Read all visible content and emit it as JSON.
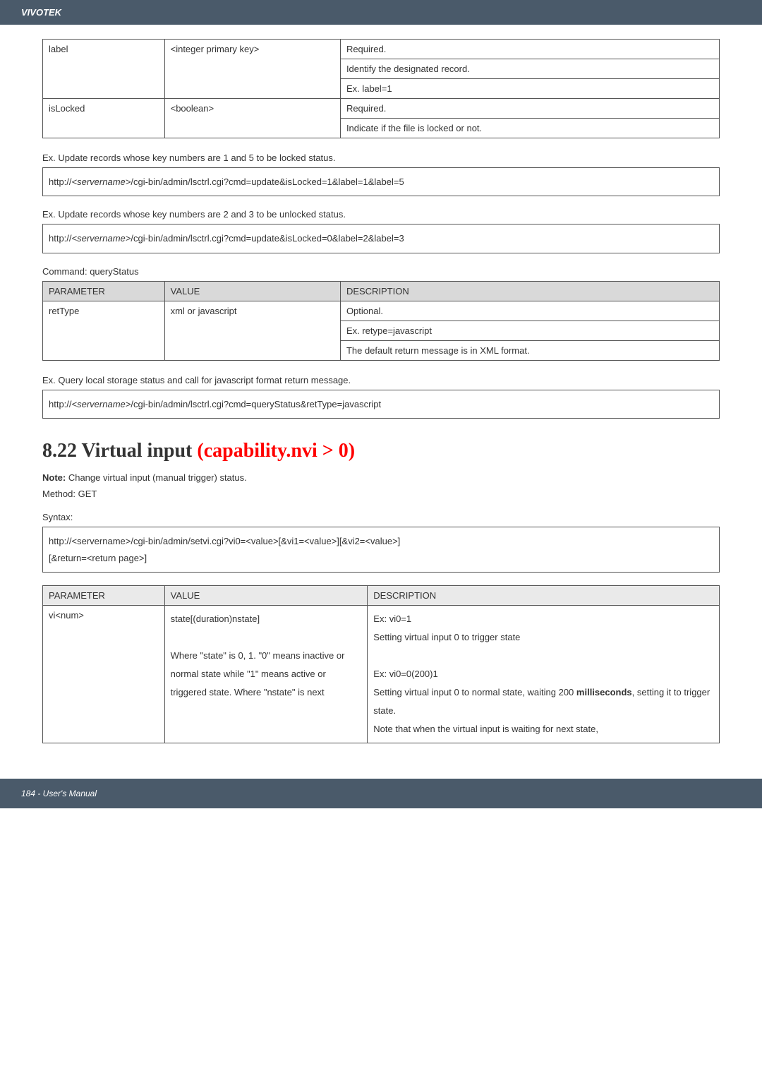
{
  "header": {
    "brand": "VIVOTEK"
  },
  "table1": {
    "rows": [
      {
        "param": "label",
        "value": "<integer primary key>",
        "desc_lines": [
          "Required.",
          "Identify the designated record.",
          "Ex. label=1"
        ]
      },
      {
        "param": "isLocked",
        "value": "<boolean>",
        "desc_lines": [
          "Required.",
          "Indicate if the file is locked or not."
        ]
      }
    ]
  },
  "ex1": {
    "caption": "Ex. Update records whose key numbers are 1 and 5 to be locked status.",
    "url_prefix": "http://",
    "url_server": "<servername>",
    "url_suffix": "/cgi-bin/admin/lsctrl.cgi?cmd=update&isLocked=1&label=1&label=5"
  },
  "ex2": {
    "caption": "Ex. Update records whose key numbers are 2 and 3 to be unlocked status.",
    "url_prefix": "http://",
    "url_server": "<servername>",
    "url_suffix": "/cgi-bin/admin/lsctrl.cgi?cmd=update&isLocked=0&label=2&label=3"
  },
  "command_label": "Command: queryStatus",
  "table2": {
    "headers": {
      "param": "PARAMETER",
      "value": "VALUE",
      "desc": "DESCRIPTION"
    },
    "rows": [
      {
        "param": "retType",
        "value": "xml or javascript",
        "desc_lines": [
          "Optional.",
          "Ex. retype=javascript",
          "The default return message is in XML format."
        ]
      }
    ]
  },
  "ex3": {
    "caption": "Ex. Query local storage status and call for javascript format return message.",
    "url_prefix": "http://",
    "url_server": "<servername>",
    "url_suffix": "/cgi-bin/admin/lsctrl.cgi?cmd=queryStatus&retType=javascript"
  },
  "section": {
    "number": "8.22 Virtual input ",
    "red": "(capability.nvi > 0)"
  },
  "note": {
    "label": "Note:",
    "text": " Change virtual input (manual trigger) status."
  },
  "method": "Method: GET",
  "syntax_label": "Syntax:",
  "syntax_box": {
    "line1": "http://<servername>/cgi-bin/admin/setvi.cgi?vi0=<value>[&vi1=<value>][&vi2=<value>]",
    "line2": "[&return=<return page>]"
  },
  "table3": {
    "headers": {
      "param": "PARAMETER",
      "value": "VALUE",
      "desc": "DESCRIPTION"
    },
    "row": {
      "param": "vi<num>",
      "value_lines": [
        "state[(duration)nstate]",
        "",
        "Where \"state\" is 0, 1. \"0\" means inactive or normal state while \"1\" means active or triggered state. Where \"nstate\" is next"
      ],
      "desc_block1": [
        "Ex: vi0=1",
        "Setting virtual input 0 to trigger state"
      ],
      "desc_block2_plain1": "Ex: vi0=0(200)1",
      "desc_block2_plain2": "Setting virtual input 0 to normal state, waiting 200 ",
      "desc_block2_bold": "milliseconds",
      "desc_block2_plain3": ", setting it to trigger state.",
      "desc_block2_plain4": "Note that when the virtual input is waiting for next state,"
    }
  },
  "footer": {
    "text": "184 - User's Manual"
  }
}
